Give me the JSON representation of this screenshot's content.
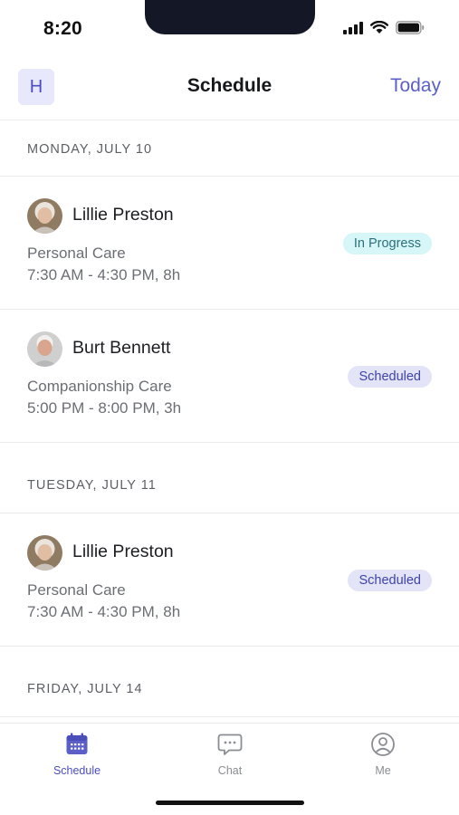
{
  "status_bar": {
    "time": "8:20"
  },
  "header": {
    "avatar_letter": "H",
    "title": "Schedule",
    "today_label": "Today"
  },
  "days": [
    {
      "date_label": "MONDAY, JULY 10",
      "visits": [
        {
          "client": "Lillie Preston",
          "service": "Personal Care",
          "hours": "7:30 AM - 4:30 PM, 8h",
          "status": "In Progress"
        },
        {
          "client": "Burt Bennett",
          "service": "Companionship Care",
          "hours": "5:00 PM - 8:00 PM, 3h",
          "status": "Scheduled"
        }
      ]
    },
    {
      "date_label": "TUESDAY, JULY 11",
      "visits": [
        {
          "client": "Lillie Preston",
          "service": "Personal Care",
          "hours": "7:30 AM - 4:30 PM, 8h",
          "status": "Scheduled"
        }
      ]
    },
    {
      "date_label": "FRIDAY, JULY 14",
      "visits": []
    }
  ],
  "tabs": [
    {
      "label": "Schedule",
      "icon": "calendar-icon",
      "active": true
    },
    {
      "label": "Chat",
      "icon": "chat-bubble-icon",
      "active": false
    },
    {
      "label": "Me",
      "icon": "user-circle-icon",
      "active": false
    }
  ],
  "colors": {
    "accent": "#5b5fc7",
    "in_progress_bg": "#d6f6f7",
    "scheduled_bg": "#e3e4f7"
  }
}
